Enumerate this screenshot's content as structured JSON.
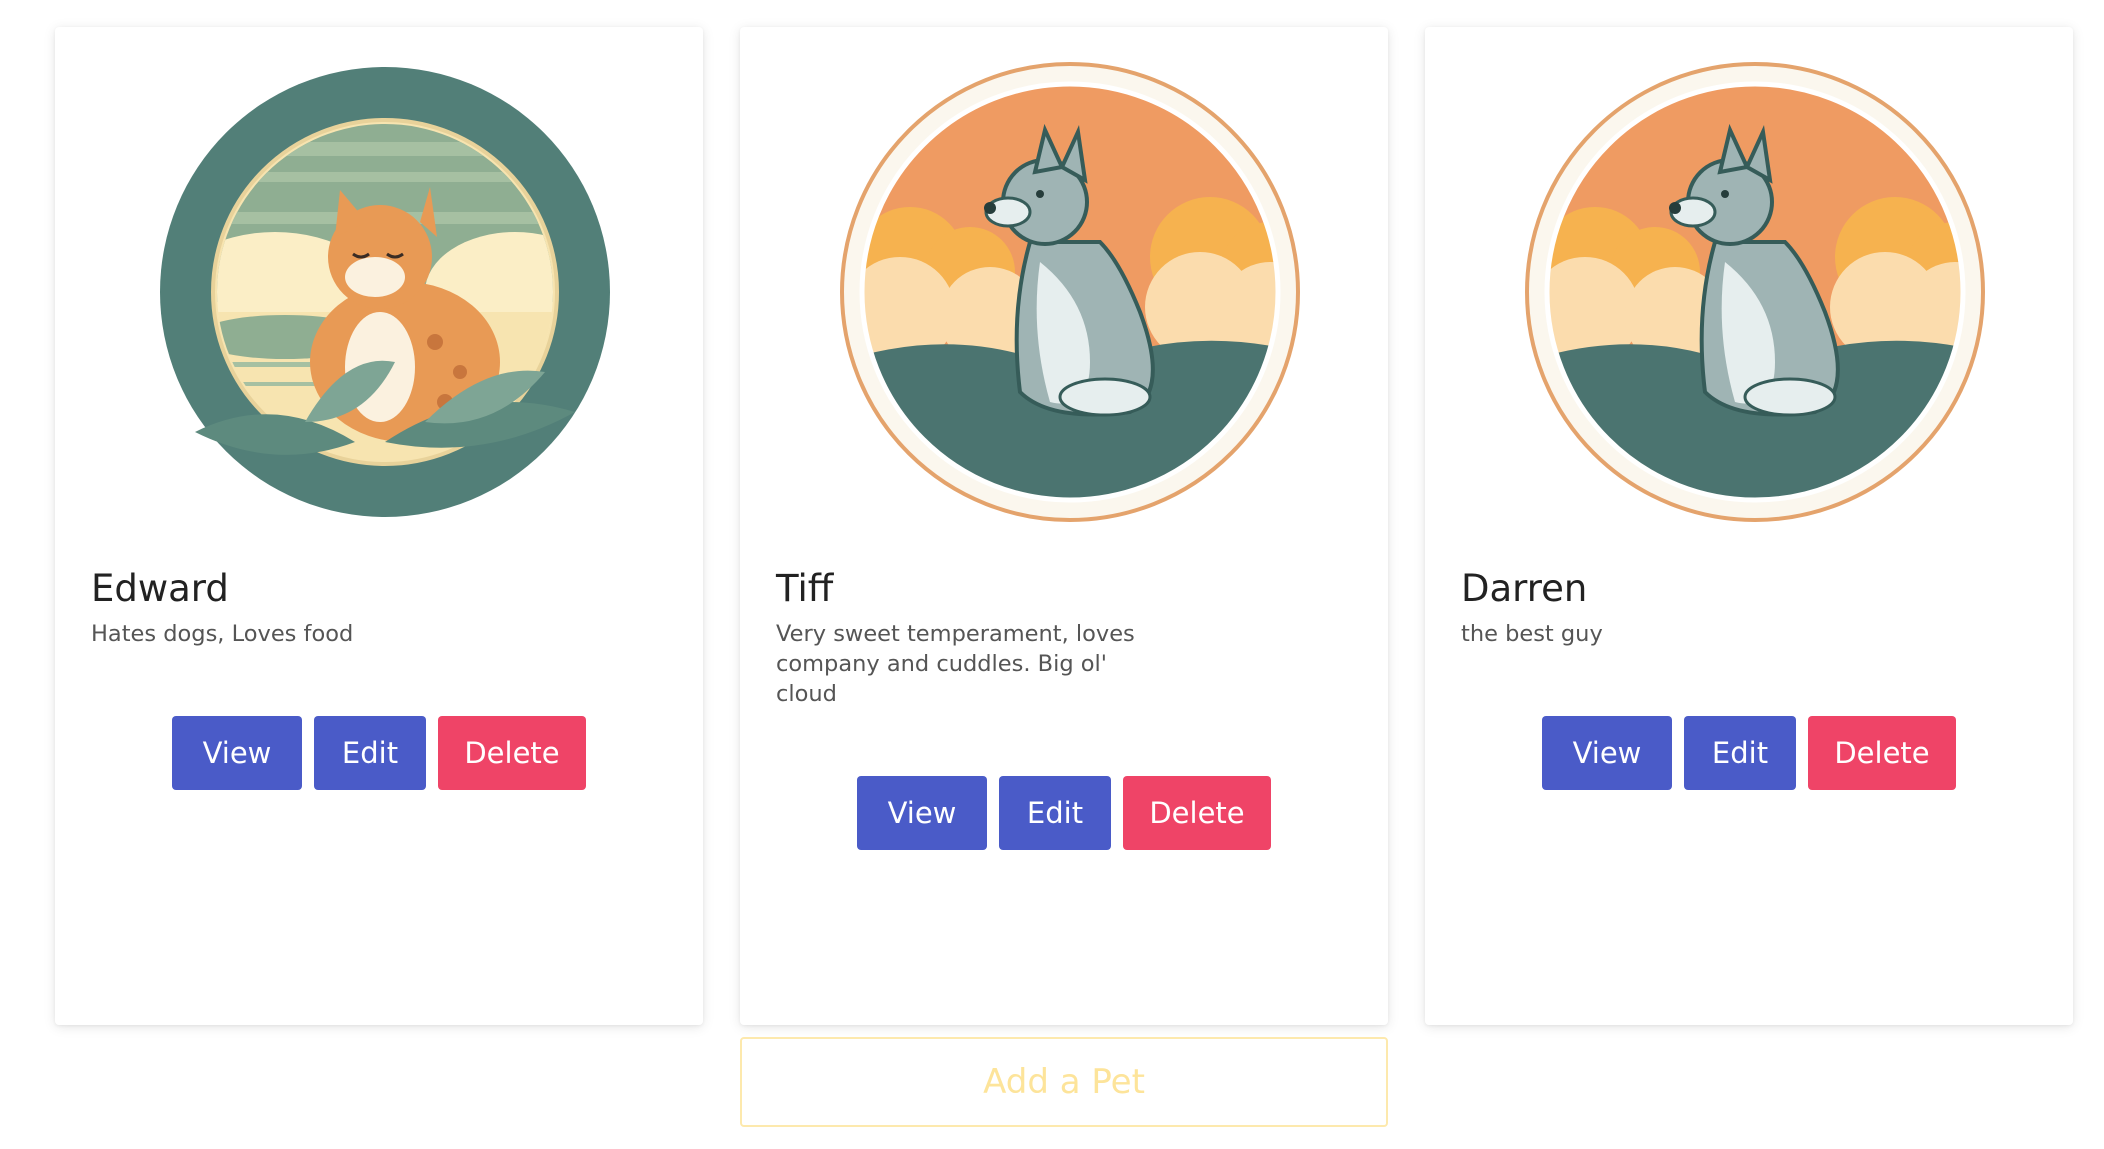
{
  "pets": [
    {
      "name": "Edward",
      "description": "Hates dogs, Loves food",
      "image_icon": "cat-portrait-icon",
      "view_label": "View",
      "edit_label": "Edit",
      "delete_label": "Delete"
    },
    {
      "name": "Tiff",
      "description": "Very sweet temperament, loves company and cuddles. Big ol' cloud",
      "image_icon": "dog-portrait-icon",
      "view_label": "View",
      "edit_label": "Edit",
      "delete_label": "Delete"
    },
    {
      "name": "Darren",
      "description": "the best guy",
      "image_icon": "dog-portrait-icon",
      "view_label": "View",
      "edit_label": "Edit",
      "delete_label": "Delete"
    }
  ],
  "add_pet_label": "Add a Pet",
  "colors": {
    "primary_button": "#4a5bc8",
    "danger_button": "#ef4467",
    "add_pet_accent": "#fde49a"
  }
}
